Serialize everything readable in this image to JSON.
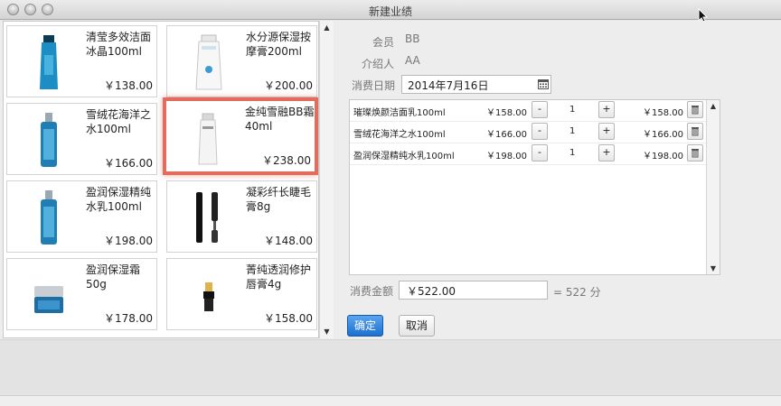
{
  "window": {
    "title": "新建业绩"
  },
  "products": [
    {
      "name": "清莹多效洁面冰晶100ml",
      "price": "￥138.00"
    },
    {
      "name": "水分源保湿按摩膏200ml",
      "price": "￥200.00"
    },
    {
      "name": "雪绒花海洋之水100ml",
      "price": "￥166.00"
    },
    {
      "name": "金纯雪融BB霜40ml",
      "price": "￥238.00"
    },
    {
      "name": "盈润保湿精纯水乳100ml",
      "price": "￥198.00"
    },
    {
      "name": "凝彩纤长睫毛膏8g",
      "price": "￥148.00"
    },
    {
      "name": "盈润保湿霜50g",
      "price": "￥178.00"
    },
    {
      "name": "菁纯透润修护唇膏4g",
      "price": "￥158.00"
    }
  ],
  "form": {
    "member_label": "会员",
    "member_value": "BB",
    "referrer_label": "介绍人",
    "referrer_value": "AA",
    "date_label": "消费日期",
    "date_value": "2014年7月16日",
    "amount_label": "消费金额",
    "amount_value": "￥522.00",
    "points_text": "= 522 分"
  },
  "order_items": [
    {
      "name": "璀璨焕颜洁面乳100ml",
      "price": "￥158.00",
      "minus": "-",
      "qty": "1",
      "plus": "+",
      "total": "￥158.00"
    },
    {
      "name": "雪绒花海洋之水100ml",
      "price": "￥166.00",
      "minus": "-",
      "qty": "1",
      "plus": "+",
      "total": "￥166.00"
    },
    {
      "name": "盈润保湿精纯水乳100ml",
      "price": "￥198.00",
      "minus": "-",
      "qty": "1",
      "plus": "+",
      "total": "￥198.00"
    }
  ],
  "buttons": {
    "confirm": "确定",
    "cancel": "取消"
  },
  "icons": {
    "close": "traffic-light-close",
    "minimize": "traffic-light-minimize",
    "zoom": "traffic-light-zoom",
    "calendar": "calendar-icon",
    "delete": "delete-icon",
    "scroll_up": "scroll-up-arrow",
    "scroll_down": "scroll-down-arrow"
  },
  "colors": {
    "accent": "#1c6fd0",
    "selection": "#e26c5d"
  }
}
